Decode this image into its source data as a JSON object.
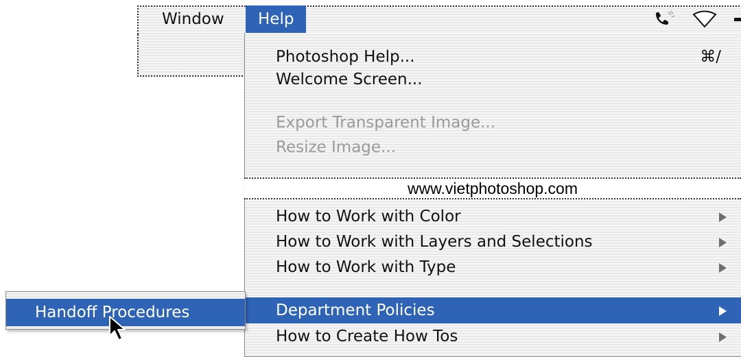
{
  "menubar": {
    "menus": [
      {
        "label": "Window"
      },
      {
        "label": "Help"
      }
    ],
    "tray_icons": [
      "phone-icon",
      "wifi-icon"
    ]
  },
  "help_menu": {
    "items": [
      {
        "label": "Photoshop Help...",
        "shortcut": "⌘/"
      },
      {
        "label": "Welcome Screen..."
      },
      {
        "label": "Export Transparent Image...",
        "disabled": true
      },
      {
        "label": "Resize Image...",
        "disabled": true
      },
      {
        "label": "How to Work with Color",
        "submenu": true
      },
      {
        "label": "How to Work with Layers and Selections",
        "submenu": true
      },
      {
        "label": "How to Work with Type",
        "submenu": true
      },
      {
        "label": "Department Policies",
        "submenu": true,
        "selected": true
      },
      {
        "label": "How to Create How Tos",
        "submenu": true
      }
    ]
  },
  "watermark": "www.vietphotoshop.com",
  "submenu": {
    "items": [
      {
        "label": "Handoff Procedures",
        "selected": true
      }
    ]
  },
  "colors": {
    "selection": "#2f63b5",
    "disabled_text": "#9a9a9a"
  }
}
